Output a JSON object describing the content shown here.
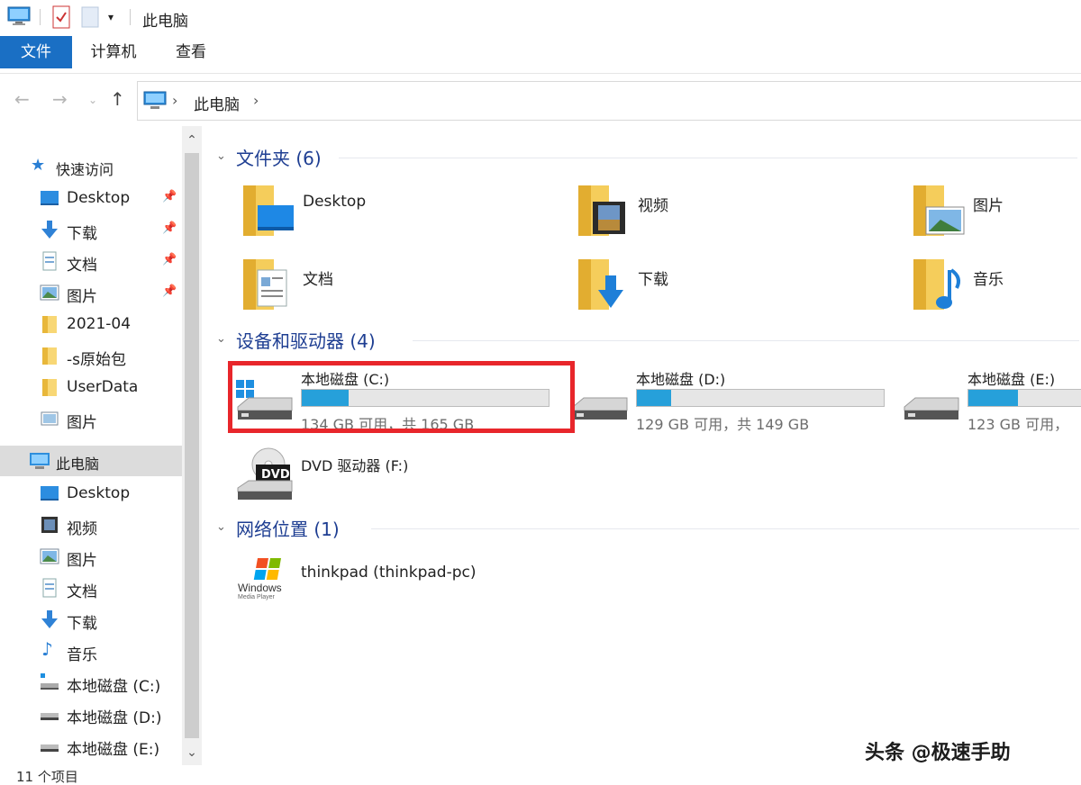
{
  "window": {
    "title": "此电脑"
  },
  "ribbon": {
    "tabs": [
      {
        "label": "文件",
        "active": true
      },
      {
        "label": "计算机",
        "active": false
      },
      {
        "label": "查看",
        "active": false
      }
    ]
  },
  "address": {
    "path": "此电脑"
  },
  "sidebar": {
    "quick_access_label": "快速访问",
    "quick_items": [
      {
        "label": "Desktop",
        "icon": "desktop-icon",
        "pinned": true
      },
      {
        "label": "下载",
        "icon": "download-icon",
        "pinned": true
      },
      {
        "label": "文档",
        "icon": "document-icon",
        "pinned": true
      },
      {
        "label": "图片",
        "icon": "picture-icon",
        "pinned": true
      },
      {
        "label": "2021-04",
        "icon": "folder-icon",
        "pinned": false
      },
      {
        "label": "-s原始包",
        "icon": "folder-icon",
        "pinned": false
      },
      {
        "label": "UserData",
        "icon": "folder-icon",
        "pinned": false
      },
      {
        "label": "图片",
        "icon": "picture-icon",
        "pinned": false
      }
    ],
    "this_pc_label": "此电脑",
    "pc_items": [
      {
        "label": "Desktop",
        "icon": "desktop-icon"
      },
      {
        "label": "视频",
        "icon": "video-icon"
      },
      {
        "label": "图片",
        "icon": "picture-icon"
      },
      {
        "label": "文档",
        "icon": "document-icon"
      },
      {
        "label": "下载",
        "icon": "download-icon"
      },
      {
        "label": "音乐",
        "icon": "music-icon"
      },
      {
        "label": "本地磁盘 (C:)",
        "icon": "system-drive-icon"
      },
      {
        "label": "本地磁盘 (D:)",
        "icon": "drive-icon"
      },
      {
        "label": "本地磁盘 (E:)",
        "icon": "drive-icon"
      }
    ]
  },
  "status_bar": {
    "item_count": "11 个项目"
  },
  "main": {
    "folders_group": "文件夹 (6)",
    "folders": [
      {
        "name": "Desktop",
        "icon": "desktop-folder-icon"
      },
      {
        "name": "视频",
        "icon": "video-folder-icon"
      },
      {
        "name": "图片",
        "icon": "pictures-folder-icon"
      },
      {
        "name": "文档",
        "icon": "documents-folder-icon"
      },
      {
        "name": "下载",
        "icon": "downloads-folder-icon"
      },
      {
        "name": "音乐",
        "icon": "music-folder-icon"
      }
    ],
    "devices_group": "设备和驱动器 (4)",
    "drives": [
      {
        "name": "本地磁盘 (C:)",
        "free": "134 GB 可用，共 165 GB",
        "used_fraction": 0.19
      },
      {
        "name": "本地磁盘 (D:)",
        "free": "129 GB 可用，共 149 GB",
        "used_fraction": 0.14
      },
      {
        "name": "本地磁盘 (E:)",
        "free": "123 GB 可用，",
        "used_fraction": 0.2
      }
    ],
    "dvd": {
      "name": "DVD 驱动器 (F:)",
      "badge": "DVD"
    },
    "network_group": "网络位置 (1)",
    "network_items": [
      {
        "name": "thinkpad (thinkpad-pc)",
        "logo_text": "Windows",
        "logo_subtext": "Media Player"
      }
    ]
  },
  "watermark": "头条 @极速手助",
  "colors": {
    "accent": "#1a6fc4",
    "group_title": "#1e3e92",
    "drive_fill": "#26a0da",
    "highlight": "#e8262b"
  }
}
